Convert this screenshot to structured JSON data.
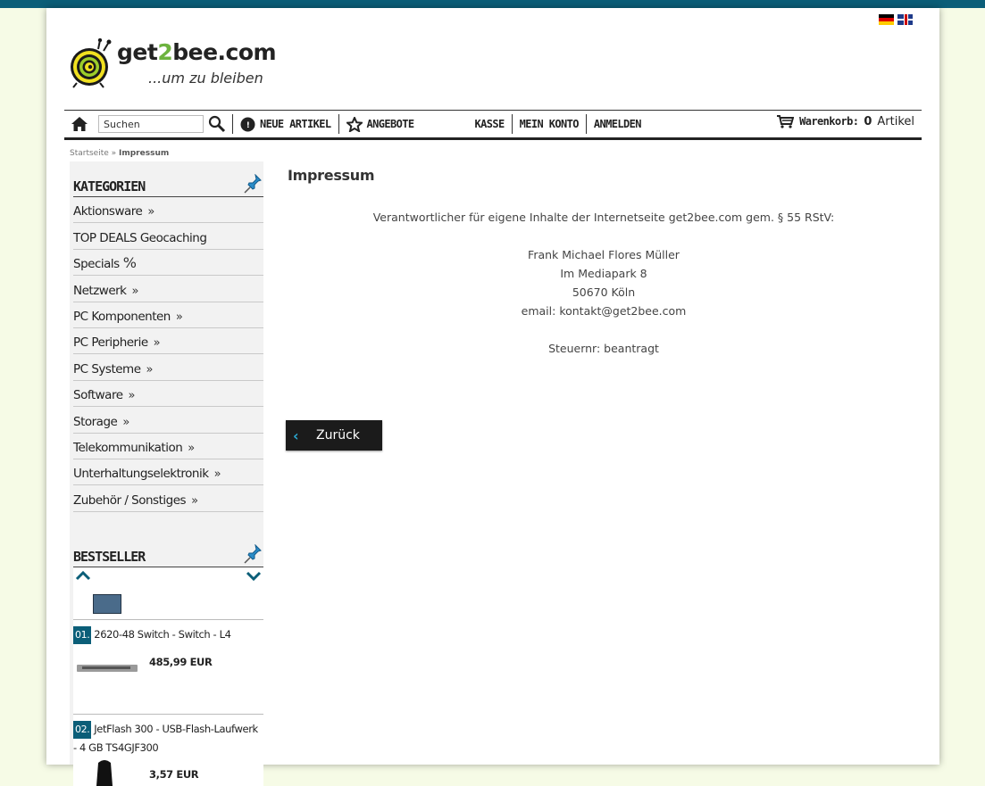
{
  "header": {
    "logo_main": "get",
    "logo_two": "2",
    "logo_rest": "bee.com",
    "tagline": "...um zu bleiben",
    "languages": [
      {
        "icon": "flag-de-icon"
      },
      {
        "icon": "flag-en-icon"
      }
    ]
  },
  "nav": {
    "search_placeholder": "Suchen",
    "new_items": "Neue Artikel",
    "offers": "Angebote",
    "checkout": "Kasse",
    "my_account": "Mein Konto",
    "login": "Anmelden",
    "cart_label": "Warenkorb:",
    "cart_count": "0",
    "cart_unit": "Artikel"
  },
  "breadcrumb": {
    "home": "Startseite",
    "sep": " » ",
    "current": "Impressum"
  },
  "sidebar": {
    "categories_title": "Kategorien",
    "categories": [
      {
        "label": "Aktionsware",
        "suffix": "»"
      },
      {
        "label": "TOP DEALS Geocaching",
        "suffix": ""
      },
      {
        "label": "Specials",
        "suffix": "%"
      },
      {
        "label": "Netzwerk",
        "suffix": "»"
      },
      {
        "label": "PC Komponenten",
        "suffix": "»"
      },
      {
        "label": "PC Peripherie",
        "suffix": "»"
      },
      {
        "label": "PC Systeme",
        "suffix": "»"
      },
      {
        "label": "Software",
        "suffix": "»"
      },
      {
        "label": "Storage",
        "suffix": "»"
      },
      {
        "label": "Telekommunikation",
        "suffix": "»"
      },
      {
        "label": "Unterhaltungselektronik",
        "suffix": "»"
      },
      {
        "label": "Zubehör / Sonstiges",
        "suffix": "»"
      }
    ],
    "bestseller_title": "Bestseller",
    "bestsellers": [
      {
        "num": "01.",
        "name": "2620-48 Switch - Switch - L4",
        "price": "485,99 EUR"
      },
      {
        "num": "02.",
        "name": "JetFlash 300 - USB-Flash-Laufwerk - 4 GB TS4GJF300",
        "price": "3,57 EUR"
      }
    ]
  },
  "content": {
    "title": "Impressum",
    "lines": [
      "Verantwortlicher für eigene Inhalte der Internetseite get2bee.com gem. § 55 RStV:",
      "",
      "Frank Michael Flores Müller",
      "Im Mediapark 8",
      "50670 Köln",
      "email: kontakt@get2bee.com",
      "",
      "Steuernr: beantragt"
    ],
    "back_label": "Zurück"
  },
  "colors": {
    "accent": "#0b5e78",
    "page_bg": "#f6fbe6",
    "logo_green": "#6db33f"
  }
}
